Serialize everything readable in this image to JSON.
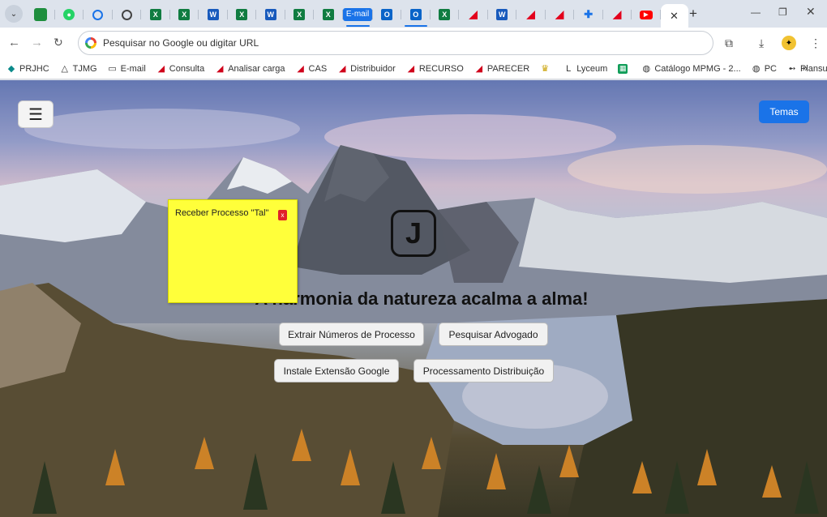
{
  "browser": {
    "tabs": [
      {
        "icon": "app-green-icon",
        "style": "green-sq",
        "glyph": ""
      },
      {
        "icon": "whatsapp-icon",
        "style": "whats",
        "glyph": "●"
      },
      {
        "icon": "web-app-icon",
        "style": "web",
        "glyph": ""
      },
      {
        "icon": "globe-icon",
        "style": "globe",
        "glyph": ""
      },
      {
        "icon": "excel-icon",
        "style": "excel",
        "glyph": "X"
      },
      {
        "icon": "excel-icon",
        "style": "excel",
        "glyph": "X"
      },
      {
        "icon": "word-icon",
        "style": "word",
        "glyph": "W"
      },
      {
        "icon": "excel-icon",
        "style": "excel",
        "glyph": "X"
      },
      {
        "icon": "word-icon",
        "style": "word",
        "glyph": "W"
      },
      {
        "icon": "excel-icon",
        "style": "excel",
        "glyph": "X"
      },
      {
        "icon": "excel-icon",
        "style": "excel",
        "glyph": "X"
      },
      {
        "icon": "email-icon",
        "style": "email",
        "glyph": "E-mail"
      },
      {
        "icon": "outlook-icon",
        "style": "outlook",
        "glyph": "O"
      },
      {
        "icon": "outlook-icon",
        "style": "outlook",
        "glyph": "O"
      },
      {
        "icon": "excel-icon",
        "style": "excel",
        "glyph": "X"
      },
      {
        "icon": "acrobat-icon",
        "style": "acrobat",
        "glyph": "◢"
      },
      {
        "icon": "word-icon",
        "style": "word",
        "glyph": "W"
      },
      {
        "icon": "acrobat-icon",
        "style": "acrobat",
        "glyph": "◢"
      },
      {
        "icon": "acrobat-icon",
        "style": "acrobat",
        "glyph": "◢"
      },
      {
        "icon": "puzzle-icon",
        "style": "puzzle",
        "glyph": "✚"
      },
      {
        "icon": "acrobat-icon",
        "style": "acrobat",
        "glyph": "◢"
      },
      {
        "icon": "youtube-icon",
        "style": "youtube",
        "glyph": "▶"
      }
    ],
    "omnibox_placeholder": "Pesquisar no Google ou digitar URL",
    "bookmarks": [
      {
        "label": "PRJHC",
        "icon": "prjhc-icon",
        "style": "teal",
        "glyph": "◆"
      },
      {
        "label": "TJMG",
        "icon": "triangle-icon",
        "style": "dark",
        "glyph": "△"
      },
      {
        "label": "E-mail",
        "icon": "folder-icon",
        "style": "dark",
        "glyph": "▭"
      },
      {
        "label": "Consulta",
        "icon": "acrobat-icon",
        "style": "red",
        "glyph": "◢"
      },
      {
        "label": "Analisar carga",
        "icon": "acrobat-icon",
        "style": "red",
        "glyph": "◢"
      },
      {
        "label": "CAS",
        "icon": "acrobat-icon",
        "style": "red",
        "glyph": "◢"
      },
      {
        "label": "Distribuidor",
        "icon": "acrobat-icon",
        "style": "red",
        "glyph": "◢"
      },
      {
        "label": "RECURSO",
        "icon": "acrobat-icon",
        "style": "red",
        "glyph": "◢"
      },
      {
        "label": "PARECER",
        "icon": "acrobat-icon",
        "style": "red",
        "glyph": "◢"
      },
      {
        "label": "",
        "icon": "trophy-icon",
        "style": "gold",
        "glyph": "♛"
      },
      {
        "label": "Lyceum",
        "icon": "lyceum-icon",
        "style": "dark",
        "glyph": "L"
      },
      {
        "label": "",
        "icon": "sheets-icon",
        "style": "sheet",
        "glyph": "▦"
      },
      {
        "label": "Catálogo MPMG - 2...",
        "icon": "globe-icon",
        "style": "dark",
        "glyph": "◍"
      },
      {
        "label": "PC",
        "icon": "globe-icon",
        "style": "dark",
        "glyph": "◍"
      },
      {
        "label": "Plansul",
        "icon": "plansul-icon",
        "style": "dark",
        "glyph": "➻"
      },
      {
        "label": "",
        "icon": "info-icon",
        "style": "dark",
        "glyph": "ⓘ"
      }
    ],
    "bookmarks_more": "»"
  },
  "page": {
    "menu_label": "☰",
    "temas_label": "Temas",
    "logo_letter": "J",
    "headline": "A harmonia da natureza acalma a alma!",
    "buttons": {
      "extrair": "Extrair Números de Processo",
      "pesquisar": "Pesquisar Advogado",
      "instale": "Instale Extensão Google",
      "processamento": "Processamento Distribuição"
    },
    "sticky_note": {
      "text": "Receber Processo \"Tal\"",
      "close": "x",
      "color": "#ffff3a"
    },
    "accent_color": "#1a73e8"
  }
}
